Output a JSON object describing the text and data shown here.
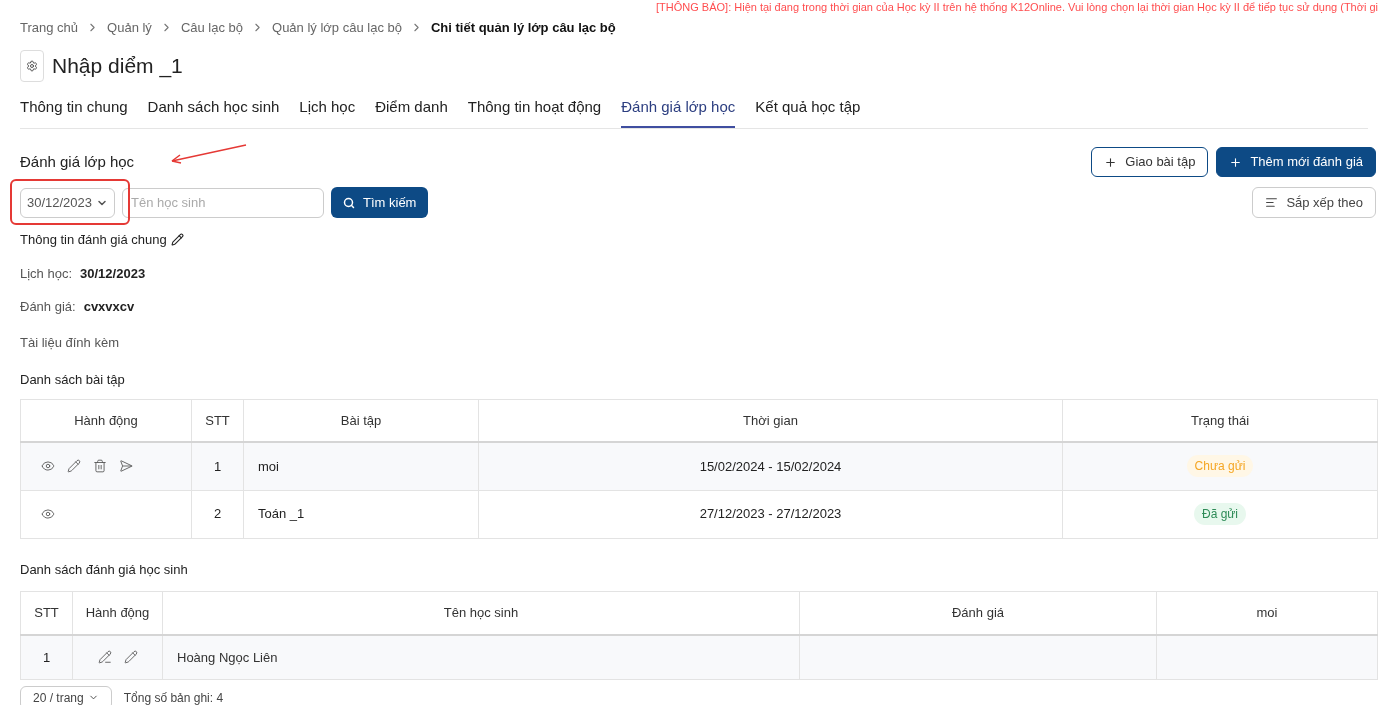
{
  "notice": "[THÔNG BÁO]: Hiện tại đang trong thời gian của Học kỳ II trên hệ thống K12Online. Vui lòng chọn lại thời gian Học kỳ II để tiếp tục sử dụng (Thời gi",
  "breadcrumb": [
    {
      "label": "Trang chủ",
      "current": false
    },
    {
      "label": "Quản lý",
      "current": false
    },
    {
      "label": "Câu lạc bộ",
      "current": false
    },
    {
      "label": "Quản lý lớp câu lạc bộ",
      "current": false
    },
    {
      "label": "Chi tiết quản lý lớp câu lạc bộ",
      "current": true
    }
  ],
  "page_title": "Nhập diểm _1",
  "tabs": [
    {
      "label": "Thông tin chung",
      "selected": false
    },
    {
      "label": "Danh sách học sinh",
      "selected": false
    },
    {
      "label": "Lịch học",
      "selected": false
    },
    {
      "label": "Điểm danh",
      "selected": false
    },
    {
      "label": "Thông tin hoạt động",
      "selected": false
    },
    {
      "label": "Đánh giá lớp học",
      "selected": true
    },
    {
      "label": "Kết quả học tập",
      "selected": false
    }
  ],
  "section_title": "Đánh giá lớp học",
  "header_buttons": [
    {
      "label": "Giao bài tập",
      "kind": "outline"
    },
    {
      "label": "Thêm mới đánh giá",
      "kind": "primary"
    }
  ],
  "filters": {
    "date": "30/12/2023",
    "name_placeholder": "Tên học sinh",
    "search_button": "Tìm kiếm",
    "sort_button": "Sắp xếp theo"
  },
  "general_info": {
    "title": "Thông tin đánh giá chung",
    "fields": [
      {
        "label": "Lịch học:",
        "value": "30/12/2023"
      },
      {
        "label": "Đánh giá:",
        "value": "cvxvxcv"
      }
    ],
    "attachments_label": "Tài liệu đính kèm"
  },
  "assignments": {
    "title": "Danh sách bài tập",
    "columns": [
      "Hành động",
      "STT",
      "Bài tập",
      "Thời gian",
      "Trạng thái"
    ],
    "rows": [
      {
        "actions": [
          {
            "kind": "view"
          },
          {
            "kind": "edit"
          },
          {
            "kind": "delete"
          },
          {
            "kind": "send"
          }
        ],
        "stt": "1",
        "name": "moi",
        "time": "15/02/2024 - 15/02/2024",
        "status": {
          "label": "Chưa gửi",
          "kind": "pending"
        }
      },
      {
        "actions": [
          {
            "kind": "view"
          }
        ],
        "stt": "2",
        "name": "Toán _1",
        "time": "27/12/2023 - 27/12/2023",
        "status": {
          "label": "Đã gửi",
          "kind": "sent"
        }
      }
    ]
  },
  "student_reviews": {
    "title": "Danh sách đánh giá học sinh",
    "columns": [
      "STT",
      "Hành động",
      "Tên học sinh",
      "Đánh giá",
      "moi"
    ],
    "rows": [
      {
        "stt": "1",
        "actions": [
          {
            "kind": "edit_line"
          },
          {
            "kind": "edit"
          }
        ],
        "name": "Hoàng Ngọc Liên"
      }
    ]
  },
  "pagination": {
    "page_size": "20 / trang",
    "total": "Tổng số bản ghi: 4"
  }
}
